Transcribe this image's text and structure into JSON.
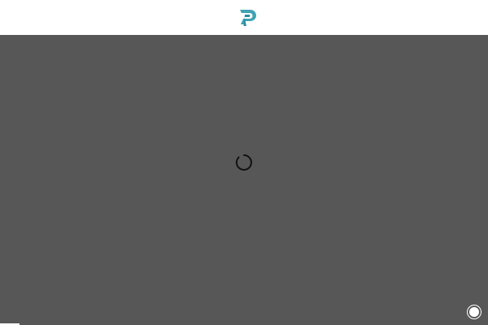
{
  "header": {
    "logo_icon": "brand-logo-icon",
    "logo_color": "#3fa3b3",
    "background": "#ffffff"
  },
  "main": {
    "background": "#575757",
    "spinner_icon": "loading-spinner-icon",
    "spinner_color": "#111111"
  },
  "overlay": {
    "fab_icon": "circle-button-icon",
    "fab_color": "#ffffff"
  }
}
